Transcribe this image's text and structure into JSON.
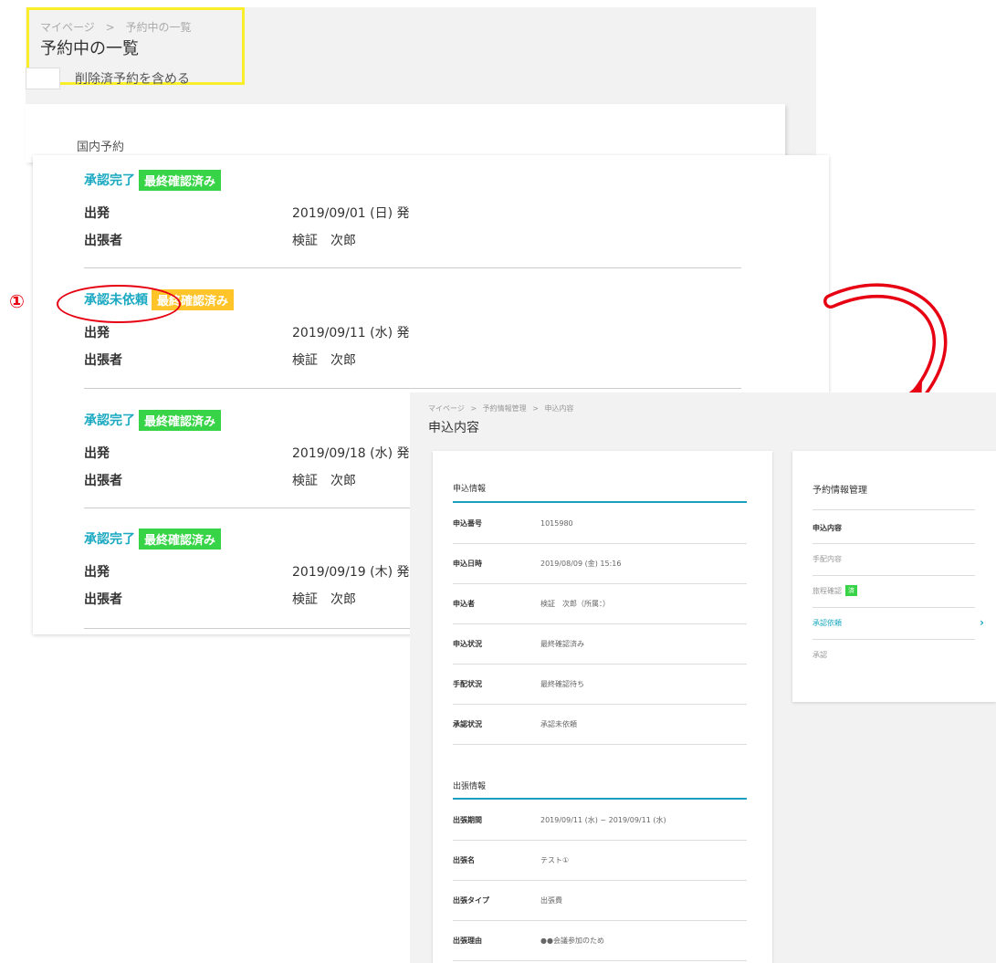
{
  "breadcrumb": [
    "マイページ",
    ">",
    "予約中の一覧"
  ],
  "page_title": "予約中の一覧",
  "include_deleted_label": "削除済予約を含める",
  "section_label": "国内予約",
  "annotation_number": "①",
  "fields": {
    "departure": "出発",
    "traveler": "出張者"
  },
  "reservations": [
    {
      "status": "承認完了",
      "badge": "最終確認済み",
      "badge_color": "#37d447",
      "departure": "2019/09/01 (日) 発",
      "traveler": "検証　次郎"
    },
    {
      "status": "承認未依頼",
      "badge": "最終確認済み",
      "badge_color": "#fec42a",
      "departure": "2019/09/11 (水) 発",
      "traveler": "検証　次郎"
    },
    {
      "status": "承認完了",
      "badge": "最終確認済み",
      "badge_color": "#37d447",
      "departure": "2019/09/18 (水) 発",
      "traveler": "検証　次郎"
    },
    {
      "status": "承認完了",
      "badge": "最終確認済み",
      "badge_color": "#37d447",
      "departure": "2019/09/19 (木) 発",
      "traveler": "検証　次郎"
    }
  ],
  "detail": {
    "breadcrumb": [
      "マイページ",
      ">",
      "予約情報管理",
      ">",
      "申込内容"
    ],
    "title": "申込内容",
    "application_group": {
      "title": "申込情報",
      "rows": [
        {
          "k": "申込番号",
          "v": "1015980"
        },
        {
          "k": "申込日時",
          "v": "2019/08/09 (金) 15:16"
        },
        {
          "k": "申込者",
          "v": "検証　次郎（所属：）"
        },
        {
          "k": "申込状況",
          "v": "最終確認済み"
        },
        {
          "k": "手配状況",
          "v": "最終確認待ち"
        },
        {
          "k": "承認状況",
          "v": "承認未依頼"
        }
      ]
    },
    "trip_group": {
      "title": "出張情報",
      "rows": [
        {
          "k": "出張期間",
          "v": "2019/09/11 (水) ~ 2019/09/11 (水)"
        },
        {
          "k": "出張名",
          "v": "テスト①"
        },
        {
          "k": "出張タイプ",
          "v": "出張費"
        },
        {
          "k": "出張理由",
          "v": "●●会議参加のため"
        }
      ]
    }
  },
  "side_menu": {
    "title": "予約情報管理",
    "items": [
      {
        "label": "申込内容",
        "state": "active"
      },
      {
        "label": "手配内容",
        "state": "normal"
      },
      {
        "label": "旅程確認",
        "state": "normal",
        "badge": "済"
      },
      {
        "label": "承認依頼",
        "state": "link",
        "chevron": "›"
      },
      {
        "label": "承認",
        "state": "normal"
      }
    ]
  },
  "colors": {
    "accent": "#1aa9c1",
    "badge_green": "#37d447",
    "badge_yellow": "#fec42a",
    "annotation_red": "#e60012",
    "highlight_yellow": "#f8ee29"
  }
}
